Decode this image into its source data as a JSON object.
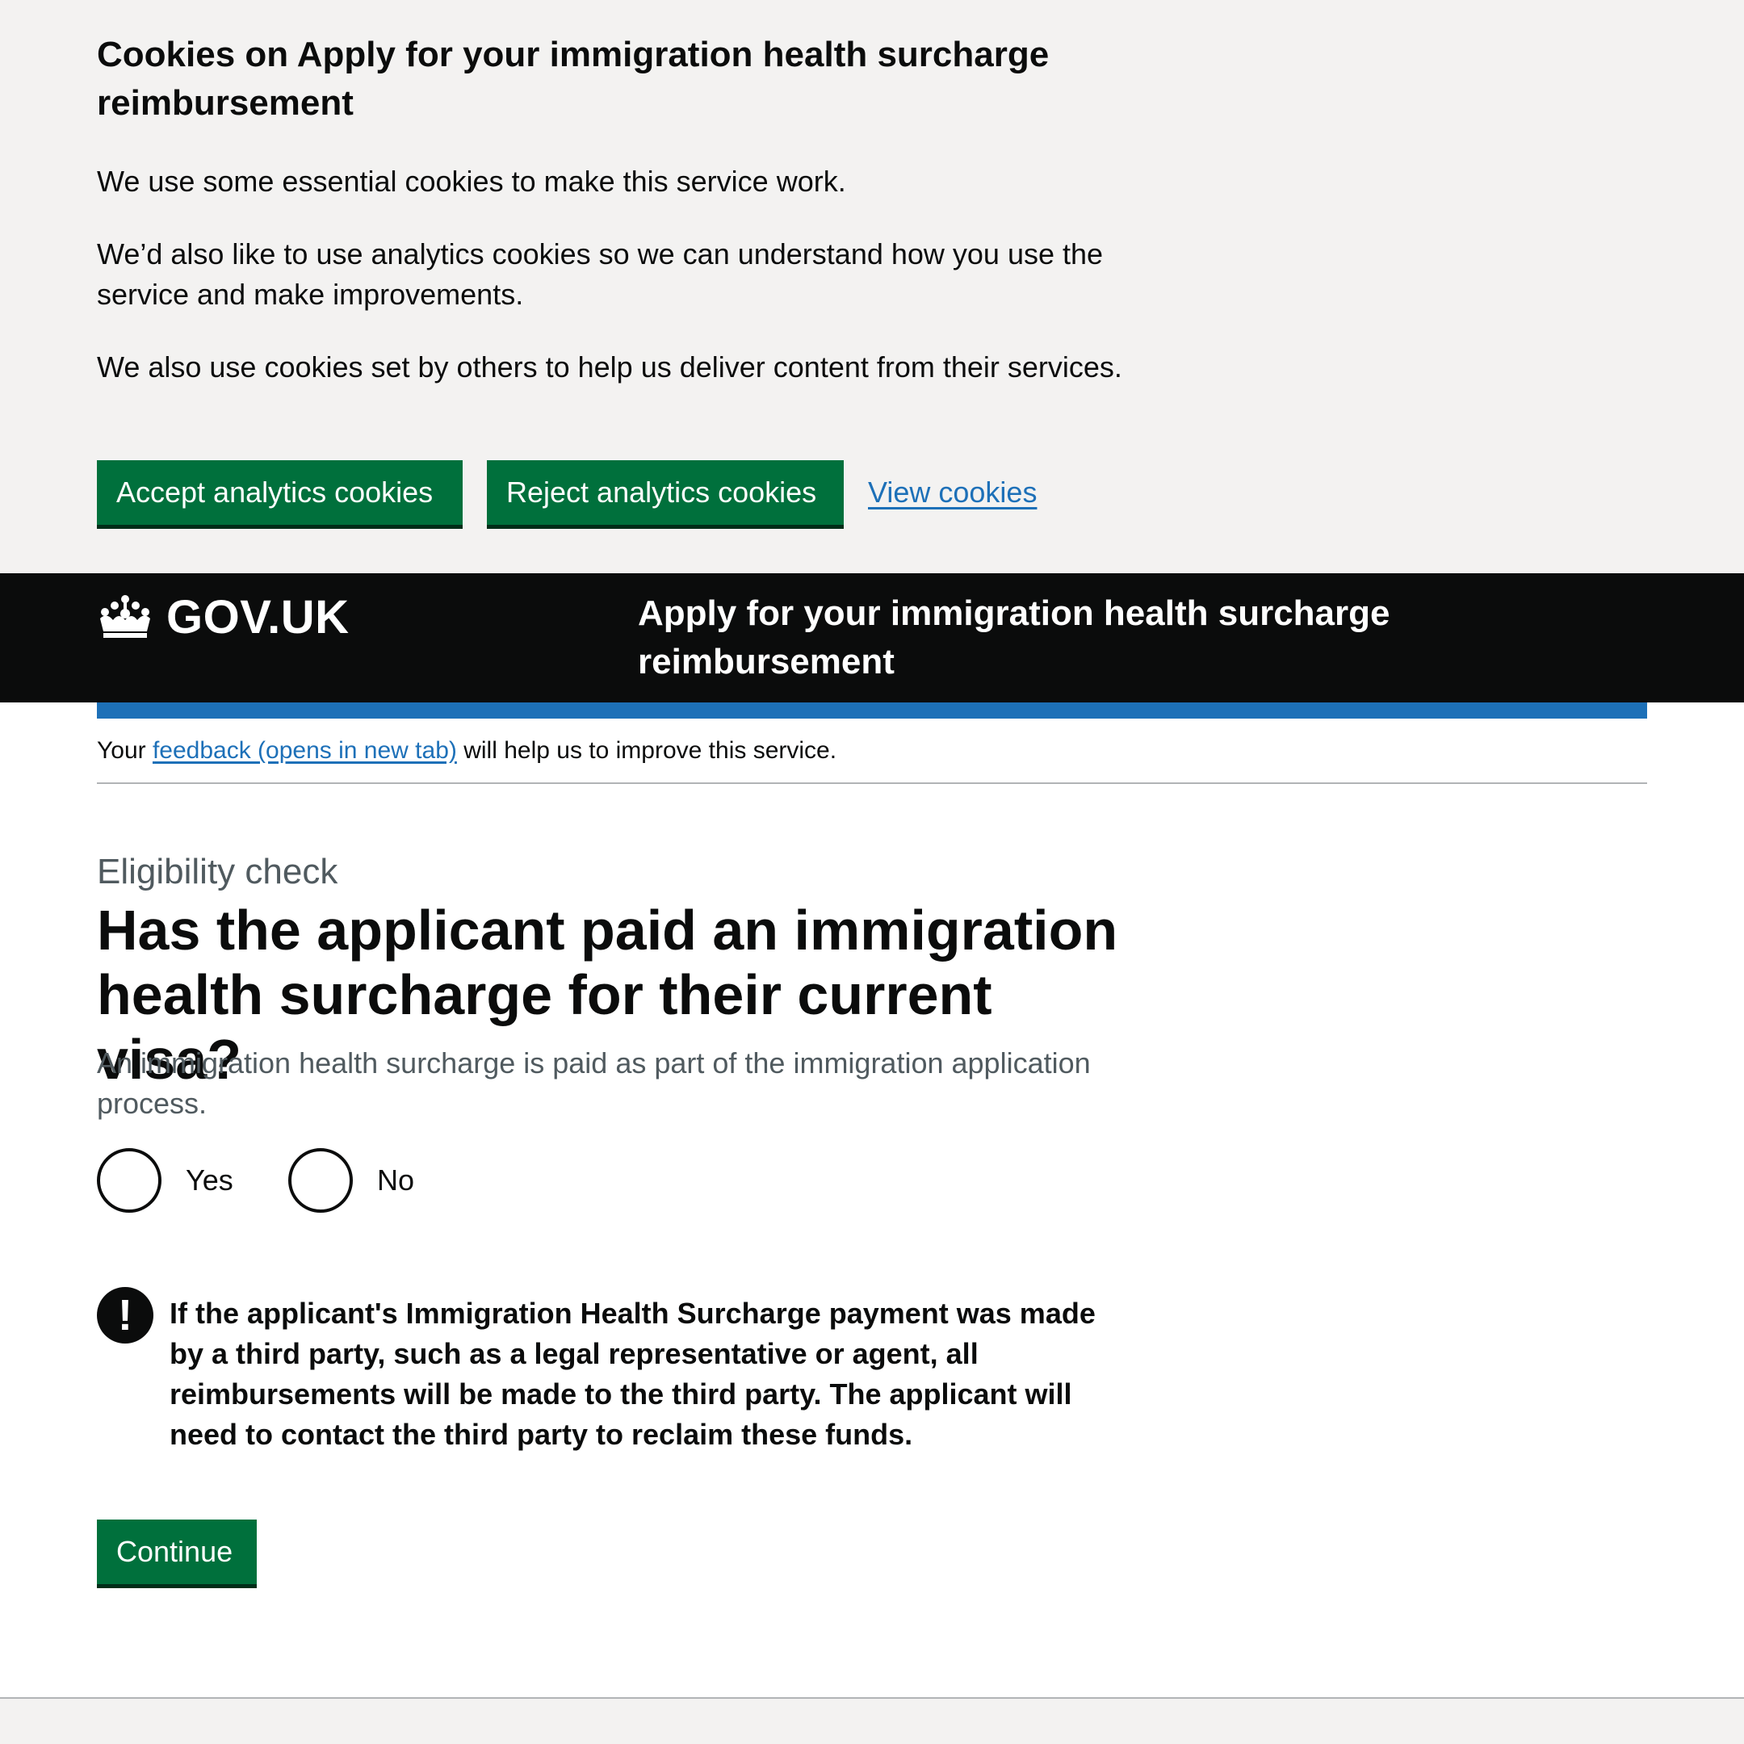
{
  "cookie_banner": {
    "title": "Cookies on Apply for your immigration health surcharge reimbursement",
    "p1": "We use some essential cookies to make this service work.",
    "p2": "We’d also like to use analytics cookies so we can understand how you use the service and make improvements.",
    "p3": "We also use cookies set by others to help us deliver content from their services.",
    "accept_label": "Accept analytics cookies",
    "reject_label": "Reject analytics cookies",
    "view_label": "View cookies"
  },
  "header": {
    "logo_text": "GOV.UK",
    "logo_icon": "crown-icon",
    "service_name": "Apply for your immigration health surcharge reimbursement"
  },
  "feedback": {
    "prefix": "Your",
    "link": "feedback (opens in new tab)",
    "suffix": "will help us to improve this service."
  },
  "main": {
    "caption": "Eligibility check",
    "question": "Has the applicant paid an immigration health surcharge for their current visa?",
    "hint": "An immigration health surcharge is paid as part of the immigration application process.",
    "options": [
      {
        "label": "Yes"
      },
      {
        "label": "No"
      }
    ],
    "warning_icon_glyph": "!",
    "warning_text": "If the applicant's Immigration Health Surcharge payment was made by a third party, such as a legal representative or agent, all reimbursements will be made to the third party. The applicant will need to contact the third party to reclaim these funds.",
    "continue_label": "Continue"
  },
  "colors": {
    "button_green": "#00703c",
    "link_blue": "#1d70b8",
    "header_black": "#0b0c0c",
    "banner_grey": "#f3f2f1",
    "secondary_text": "#505a5f"
  }
}
